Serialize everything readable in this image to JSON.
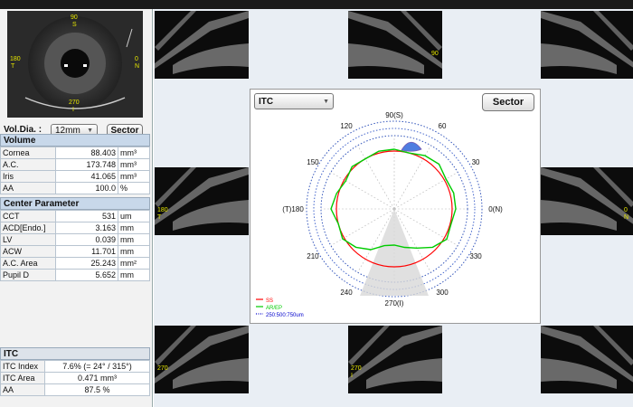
{
  "eye_labels": {
    "top": "90",
    "top2": "S",
    "left": "180",
    "left2": "T",
    "right": "0",
    "right2": "N",
    "bottom": "270",
    "bottom2": "I"
  },
  "controls": {
    "voldia_label": "Vol.Dia. :",
    "voldia_value": "12mm",
    "sector_btn": "Sector"
  },
  "volume": {
    "title": "Volume",
    "rows": [
      {
        "name": "Cornea",
        "value": "88.403",
        "unit": "mm³"
      },
      {
        "name": "A.C.",
        "value": "173.748",
        "unit": "mm³"
      },
      {
        "name": "Iris",
        "value": "41.065",
        "unit": "mm³"
      },
      {
        "name": "AA",
        "value": "100.0",
        "unit": "%"
      }
    ]
  },
  "center_param": {
    "title": "Center Parameter",
    "rows": [
      {
        "name": "CCT",
        "value": "531",
        "unit": "um"
      },
      {
        "name": "ACD[Endo.]",
        "value": "3.163",
        "unit": "mm"
      },
      {
        "name": "LV",
        "value": "0.039",
        "unit": "mm"
      },
      {
        "name": "ACW",
        "value": "11.701",
        "unit": "mm"
      },
      {
        "name": "A.C. Area",
        "value": "25.243",
        "unit": "mm²"
      },
      {
        "name": "Pupil D",
        "value": "5.652",
        "unit": "mm"
      }
    ]
  },
  "itc": {
    "title": "ITC",
    "rows": [
      {
        "name": "ITC Index",
        "value": "7.6% (= 24° / 315°)"
      },
      {
        "name": "ITC Area",
        "value": "0.471 mm³"
      },
      {
        "name": "AA",
        "value": "87.5 %"
      }
    ]
  },
  "oct_labels": {
    "t90": "90",
    "t0": "0",
    "t180": "180",
    "t270": "270",
    "t270b": "I",
    "t180b": "T",
    "t0b": "N"
  },
  "polar": {
    "dropdown": "ITC",
    "sector_btn": "Sector",
    "angles": {
      "a90": "90(S)",
      "a60": "60",
      "a30": "30",
      "a0": "0(N)",
      "a330": "330",
      "a300": "300",
      "a270": "270(I)",
      "a240": "240",
      "a210": "210",
      "a180": "(T)180",
      "a150": "150",
      "a120": "120"
    },
    "legend": {
      "ss": "SS",
      "arep": "AR/EP",
      "circles": "250:500:750um"
    },
    "colors": {
      "ss": "#ff0000",
      "arep": "#00cc00",
      "circles": "#0000cc",
      "itc": "#4f7de0"
    }
  }
}
